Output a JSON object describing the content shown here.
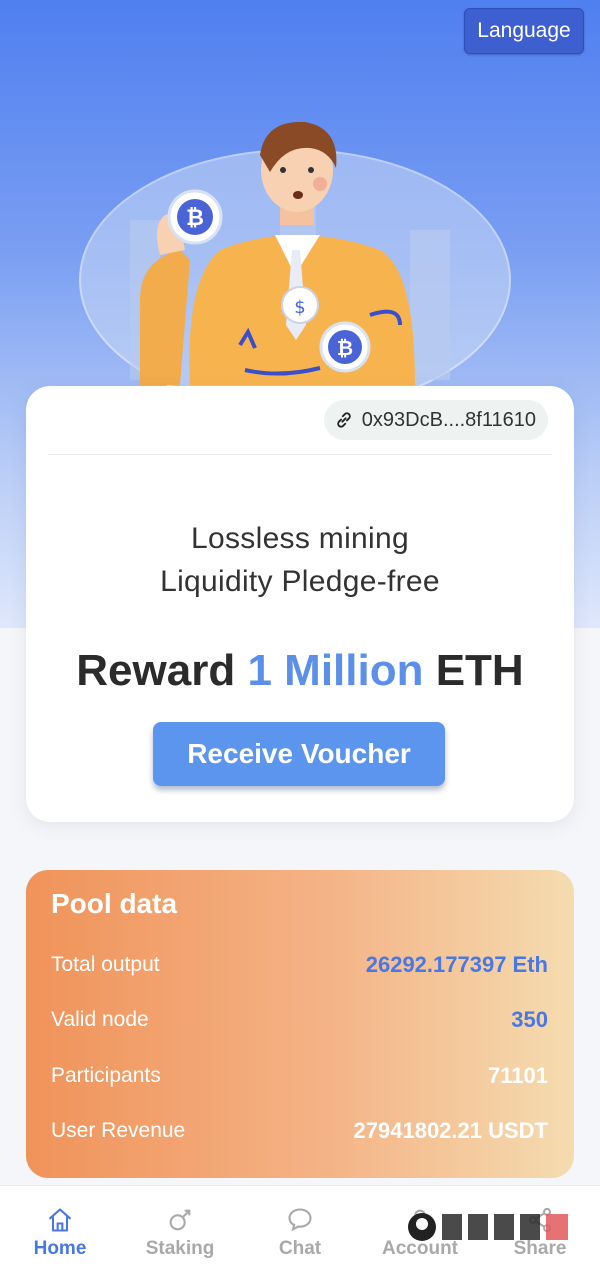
{
  "header": {
    "language_label": "Language"
  },
  "card": {
    "wallet_address": "0x93DcB....8f11610",
    "tagline_line1": "Lossless mining",
    "tagline_line2": "Liquidity Pledge-free",
    "reward_prefix": "Reward",
    "reward_amount": "1 Million",
    "reward_suffix": "ETH",
    "voucher_button": "Receive Voucher"
  },
  "pool": {
    "title": "Pool data",
    "rows": [
      {
        "label": "Total output",
        "value": "26292.177397 Eth"
      },
      {
        "label": "Valid node",
        "value": "350"
      },
      {
        "label": "Participants",
        "value": "71101"
      },
      {
        "label": "User Revenue",
        "value": "27941802.21 USDT"
      }
    ]
  },
  "tabs": [
    {
      "label": "Home",
      "icon": "home-icon",
      "active": true
    },
    {
      "label": "Staking",
      "icon": "staking-icon",
      "active": false
    },
    {
      "label": "Chat",
      "icon": "chat-icon",
      "active": false
    },
    {
      "label": "Account",
      "icon": "account-icon",
      "active": false
    },
    {
      "label": "Share",
      "icon": "share-icon",
      "active": false
    }
  ],
  "colors": {
    "accent_blue": "#5b8fe8",
    "header_blue": "#4f7ff0",
    "pool_orange": "#f0935a"
  }
}
